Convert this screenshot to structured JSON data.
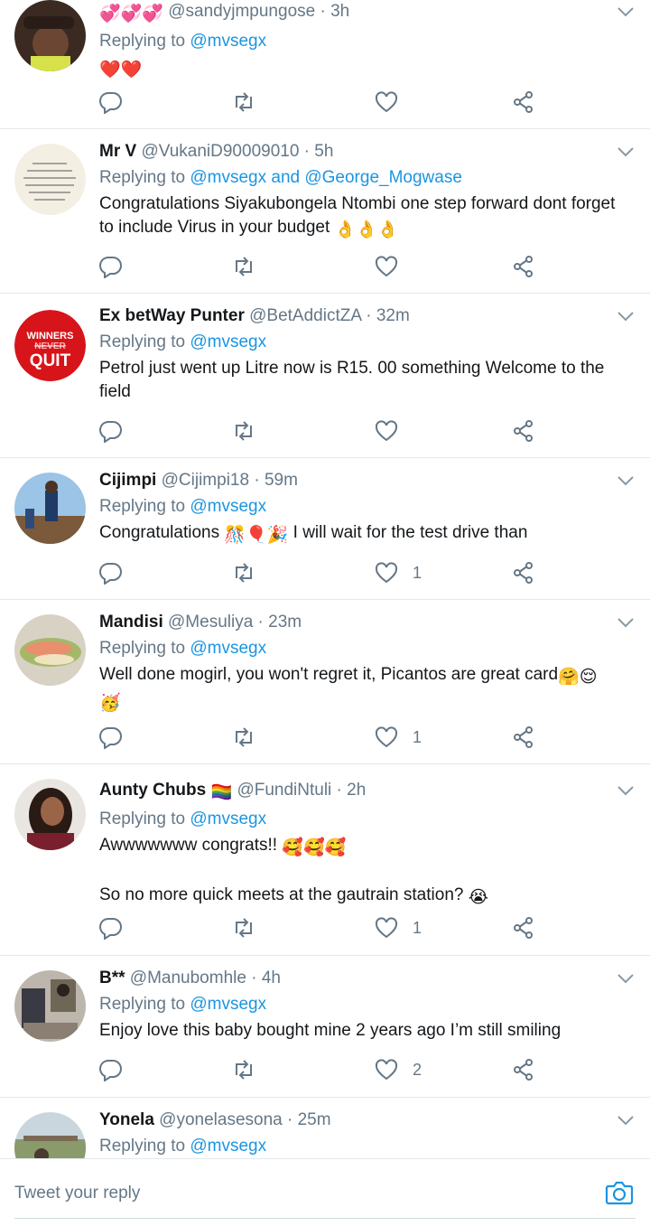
{
  "tweets": [
    {
      "name": "",
      "name_emoji": "💞💞💞",
      "handle": "@sandyjmpungose",
      "time": "3h",
      "replying_prefix": "Replying to",
      "mentions": "@mvsegx",
      "text": "",
      "text_emoji": "❤️❤️",
      "likes": ""
    },
    {
      "name": "Mr V",
      "handle": "@VukaniD90009010",
      "time": "5h",
      "replying_prefix": "Replying to",
      "mentions": "@mvsegx and @George_Mogwase",
      "text": "Congratulations Siyakubongela Ntombi one step forward dont forget to include Virus in your budget",
      "text_emoji": "👌👌👌",
      "likes": ""
    },
    {
      "name": "Ex betWay Punter",
      "handle": "@BetAddictZA",
      "time": "32m",
      "replying_prefix": "Replying to",
      "mentions": "@mvsegx",
      "text": "Petrol just went up Litre now is R15. 00 something Welcome to the field",
      "likes": ""
    },
    {
      "name": "Cijimpi",
      "handle": "@Cijimpi18",
      "time": "59m",
      "replying_prefix": "Replying to",
      "mentions": "@mvsegx",
      "text": "Congratulations",
      "text_emoji": "🎊🎈🎉",
      "text_after": " I will wait for the test drive than",
      "likes": "1"
    },
    {
      "name": "Mandisi",
      "handle": "@Mesuliya",
      "time": "23m",
      "replying_prefix": "Replying to",
      "mentions": "@mvsegx",
      "text": "Well done mogirl, you won't regret it, Picantos are great card",
      "text_emoji": "🤗😌",
      "text_emoji2": "🥳",
      "likes": "1"
    },
    {
      "name": "Aunty Chubs",
      "name_emoji": "🏳️‍🌈",
      "handle": "@FundiNtuli",
      "time": "2h",
      "replying_prefix": "Replying to",
      "mentions": "@mvsegx",
      "text": "Awwwwwww congrats!!",
      "text_emoji": "🥰🥰🥰",
      "text2": "So no more quick meets at the gautrain station?",
      "text2_emoji": "😭",
      "likes": "1"
    },
    {
      "name": "B**",
      "handle": "@Manubomhle",
      "time": "4h",
      "replying_prefix": "Replying to",
      "mentions": "@mvsegx",
      "text": "Enjoy love this baby bought mine 2 years ago I’m still smiling",
      "likes": "2"
    },
    {
      "name": "Yonela",
      "handle": "@yonelasesona",
      "time": "25m",
      "replying_prefix": "Replying to",
      "mentions": "@mvsegx"
    }
  ],
  "avatar_text": {
    "winners": "WINNERS",
    "never": "NEVER",
    "quit": "QUIT"
  },
  "composer": {
    "placeholder": "Tweet your reply",
    "camera_icon": "camera-icon"
  },
  "colors": {
    "accent": "#1b95e0",
    "muted": "#657786",
    "divider": "#e1e8ed"
  }
}
